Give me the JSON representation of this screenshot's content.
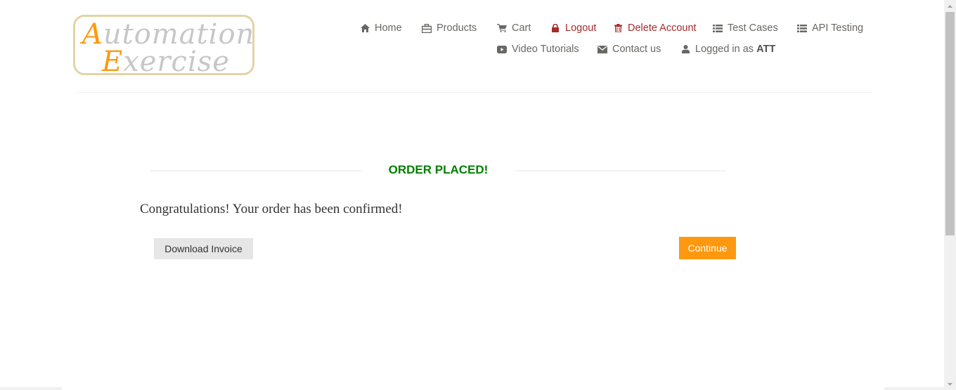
{
  "logo": {
    "line1_cap": "A",
    "line1_rest": "utomation",
    "line2_cap": "E",
    "line2_rest": "xercise"
  },
  "nav": {
    "row1": [
      {
        "label": "Home",
        "icon": "home-icon"
      },
      {
        "label": "Products",
        "icon": "products-icon"
      },
      {
        "label": "Cart",
        "icon": "cart-icon"
      },
      {
        "label": "Logout",
        "icon": "lock-icon"
      },
      {
        "label": "Delete Account",
        "icon": "trash-icon"
      },
      {
        "label": "Test Cases",
        "icon": "list-icon"
      },
      {
        "label": "API Testing",
        "icon": "list-icon"
      }
    ],
    "row2": [
      {
        "label": "Video Tutorials",
        "icon": "youtube-play-icon"
      },
      {
        "label": "Contact us",
        "icon": "envelope-icon"
      },
      {
        "label_prefix": "Logged in as ",
        "user": "ATT",
        "icon": "user-icon"
      }
    ]
  },
  "order": {
    "title": "ORDER PLACED!",
    "message": "Congratulations! Your order has been confirmed!",
    "download_label": "Download Invoice",
    "continue_label": "Continue"
  },
  "colors": {
    "accent": "#fe980f",
    "success": "#008000",
    "danger": "#a52a2a",
    "text": "#696763"
  }
}
